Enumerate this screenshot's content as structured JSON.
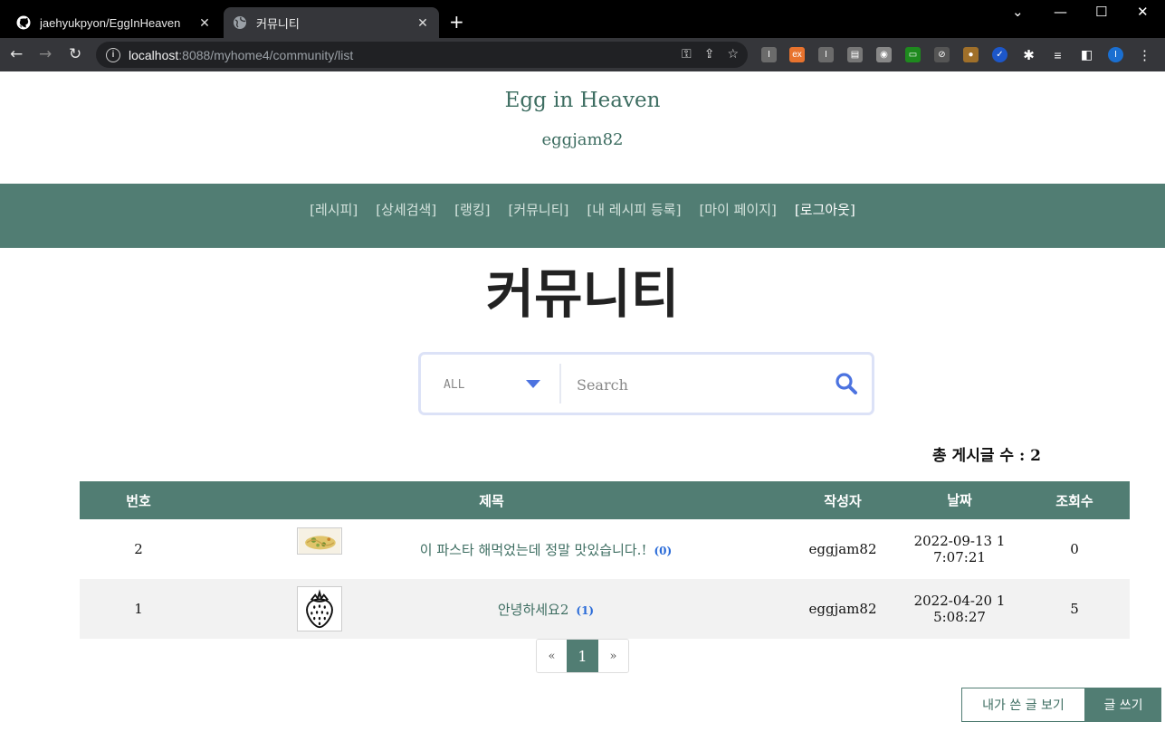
{
  "browser": {
    "tabs": [
      {
        "title": "jaehyukpyon/EggInHeaven",
        "icon": "github-icon"
      },
      {
        "title": "커뮤니티",
        "icon": "globe-icon"
      }
    ],
    "new_tab": "+",
    "url_host": "localhost",
    "url_rest": ":8088/myhome4/community/list",
    "window_controls": [
      "⌄",
      "—",
      "☐",
      "✕"
    ]
  },
  "site": {
    "title": "Egg in Heaven",
    "user": "eggjam82",
    "accent_color": "#517d73"
  },
  "nav": {
    "items": [
      "[레시피]",
      "[상세검색]",
      "[랭킹]",
      "[커뮤니티]",
      "[내 레시피 등록]",
      "[마이 페이지]",
      "[로그아웃]"
    ]
  },
  "page": {
    "heading": "커뮤니티",
    "total_label": "총 게시글 수 : 2"
  },
  "search": {
    "filter_value": "ALL",
    "placeholder": "Search"
  },
  "table": {
    "headers": {
      "no": "번호",
      "title": "제목",
      "author": "작성자",
      "date": "날짜",
      "views": "조회수"
    },
    "rows": [
      {
        "no": "2",
        "title": "이 파스타 해먹었는데 정말 맛있습니다.!",
        "comments": "(0)",
        "author": "eggjam82",
        "date_line1": "2022-09-13 1",
        "date_line2": "7:07:21",
        "views": "0"
      },
      {
        "no": "1",
        "title": "안녕하세요2",
        "comments": "(1)",
        "author": "eggjam82",
        "date_line1": "2022-04-20 1",
        "date_line2": "5:08:27",
        "views": "5"
      }
    ]
  },
  "pager": {
    "prev": "«",
    "current": "1",
    "next": "»"
  },
  "buttons": {
    "my_posts": "내가 쓴 글 보기",
    "write": "글 쓰기"
  }
}
